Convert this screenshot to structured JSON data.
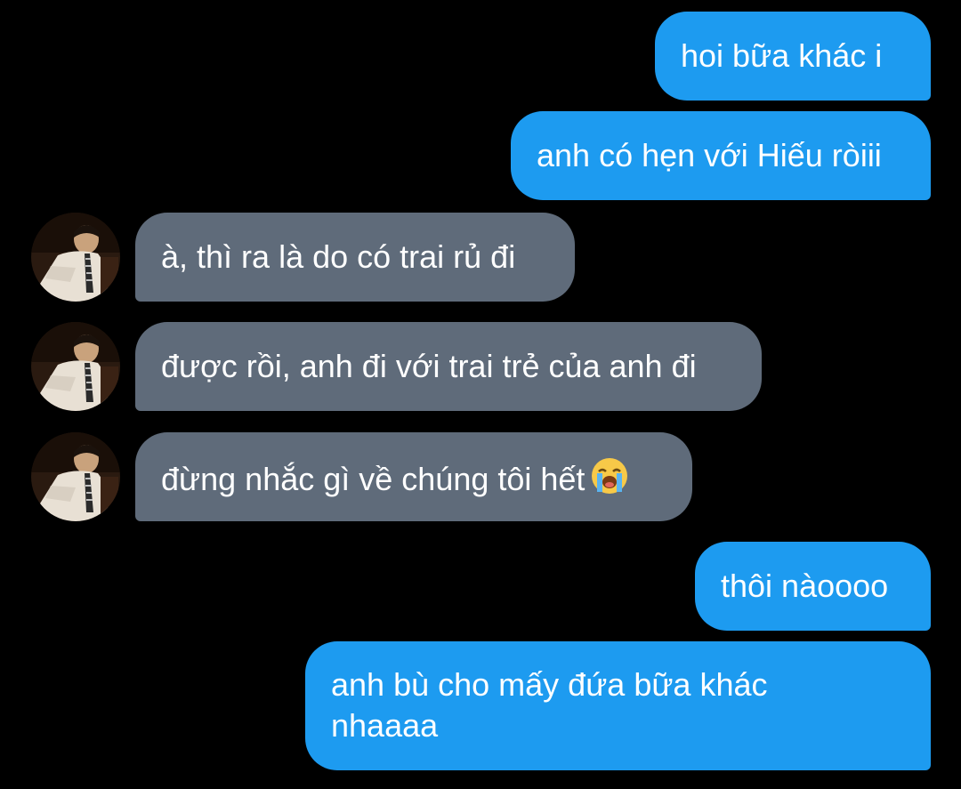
{
  "messages": [
    {
      "direction": "sent",
      "text": "hoi bữa khác i"
    },
    {
      "direction": "sent",
      "text": "anh có hẹn với Hiếu ròiii"
    },
    {
      "direction": "received",
      "text": "à, thì ra là do có trai rủ đi",
      "avatar_icon": "profile-photo"
    },
    {
      "direction": "received",
      "text": "được rồi, anh đi với trai trẻ của anh đi",
      "avatar_icon": "profile-photo"
    },
    {
      "direction": "received",
      "text": "đừng nhắc gì về chúng tôi hết",
      "emoji": "loudly-crying-face-emoji",
      "avatar_icon": "profile-photo"
    },
    {
      "direction": "sent",
      "text": "thôi nàoooo"
    },
    {
      "direction": "sent",
      "text": "anh bù cho mấy đứa bữa khác nhaaaa"
    }
  ],
  "colors": {
    "background": "#000000",
    "sent_bubble": "#1d9bf0",
    "received_bubble": "#5f6b7a",
    "text": "#ffffff"
  }
}
